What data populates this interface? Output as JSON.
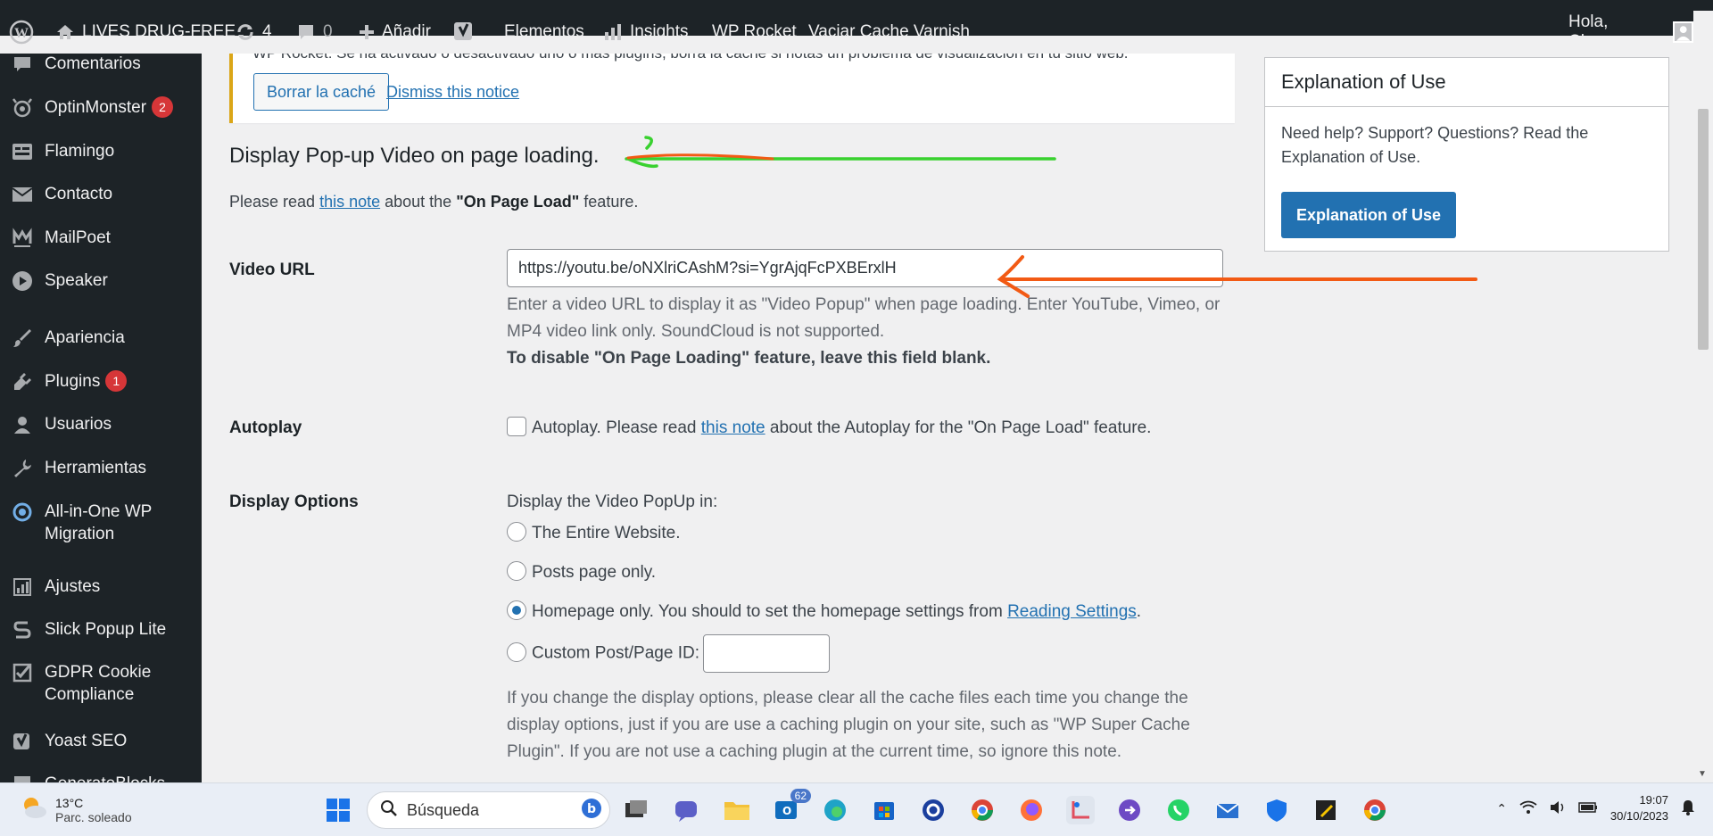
{
  "adminbar": {
    "site_name": "LIVES DRUG-FREE",
    "updates_count": "4",
    "comments_count": "0",
    "new_label": "Añadir",
    "elementos": "Elementos",
    "insights": "Insights",
    "wp_rocket": "WP Rocket",
    "varnish": "Vaciar Cache Varnish",
    "greeting": "Hola, Chuss"
  },
  "sidebar": {
    "items": [
      {
        "label": "Comentarios",
        "icon": "comment-icon"
      },
      {
        "label": "OptinMonster",
        "icon": "optinmonster-icon",
        "badge": "2"
      },
      {
        "label": "Flamingo",
        "icon": "flamingo-icon"
      },
      {
        "label": "Contacto",
        "icon": "mail-icon"
      },
      {
        "label": "MailPoet",
        "icon": "mailpoet-icon"
      },
      {
        "label": "Speaker",
        "icon": "play-icon"
      },
      {
        "label": "Apariencia",
        "icon": "brush-icon"
      },
      {
        "label": "Plugins",
        "icon": "plugin-icon",
        "badge": "1"
      },
      {
        "label": "Usuarios",
        "icon": "user-icon"
      },
      {
        "label": "Herramientas",
        "icon": "wrench-icon"
      },
      {
        "label": "All-in-One WP Migration",
        "icon": "migration-icon"
      },
      {
        "label": "Ajustes",
        "icon": "settings-icon"
      },
      {
        "label": "Slick Popup Lite",
        "icon": "popup-icon"
      },
      {
        "label": "GDPR Cookie Compliance",
        "icon": "checkbox-icon"
      },
      {
        "label": "Yoast SEO",
        "icon": "yoast-icon"
      },
      {
        "label": "GenerateBlocks",
        "icon": "blocks-icon"
      }
    ]
  },
  "notice": {
    "cut_text": "WP Rocket: Se ha activado o desactivado uno o más plugins, borra la caché si notas un problema de visualización en tu sitio web.",
    "clear_cache_button": "Borrar la caché",
    "dismiss_link": "Dismiss this notice"
  },
  "section": {
    "title": "Display Pop-up Video on page loading.",
    "desc_before": "Please read ",
    "desc_link": "this note",
    "desc_middle": " about the ",
    "desc_bold": "\"On Page Load\"",
    "desc_after": " feature."
  },
  "video_url": {
    "label": "Video URL",
    "value": "https://youtu.be/oNXlriCAshM?si=YgrAjqFcPXBErxlH",
    "help1": "Enter a video URL to display it as \"Video Popup\" when page loading. Enter YouTube, Vimeo, or MP4 video link only. SoundCloud is not supported.",
    "help2": "To disable \"On Page Loading\" feature, leave this field blank."
  },
  "autoplay": {
    "label": "Autoplay",
    "text_before": "Autoplay. Please read ",
    "link": "this note",
    "text_after": " about the Autoplay for the \"On Page Load\" feature."
  },
  "display_options": {
    "label": "Display Options",
    "intro": "Display the Video PopUp in:",
    "opt_entire": "The Entire Website.",
    "opt_posts": "Posts page only.",
    "opt_home_before": "Homepage only. You should to set the homepage settings from ",
    "opt_home_link": "Reading Settings",
    "opt_home_after": ".",
    "opt_custom": "Custom Post/Page ID:",
    "selected": "homepage",
    "note": "If you change the display options, please clear all the cache files each time you change the display options, just if you are use a caching plugin on your site, such as \"WP Super Cache Plugin\". If you are not use a caching plugin at the current time, so ignore this note."
  },
  "postbox": {
    "title": "Explanation of Use",
    "text": "Need help? Support? Questions? Read the Explanation of Use.",
    "button": "Explanation of Use"
  },
  "taskbar": {
    "temp": "13°C",
    "weather": "Parc. soleado",
    "search_placeholder": "Búsqueda",
    "mail_badge": "62",
    "time": "19:07",
    "date": "30/10/2023"
  },
  "colors": {
    "annotation_green": "#39d12f",
    "annotation_orange": "#f25a14",
    "wp_blue": "#2271b1",
    "admin_dark": "#1d2327"
  }
}
